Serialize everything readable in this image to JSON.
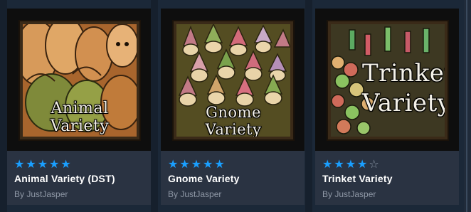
{
  "cards": [
    {
      "art_text": "Animal Variety",
      "rating": 5,
      "stars": [
        "★",
        "★",
        "★",
        "★",
        "★"
      ],
      "title": "Animal Variety (DST)",
      "author": "By JustJasper",
      "colors": {
        "bg": "#b9793a",
        "accent": "#6d7b2d"
      }
    },
    {
      "art_text": "Gnome Variety",
      "rating": 5,
      "stars": [
        "★",
        "★",
        "★",
        "★",
        "★"
      ],
      "title": "Gnome Variety",
      "author": "By JustJasper",
      "colors": {
        "bg": "#5a5224",
        "accent": "#c67e88"
      }
    },
    {
      "art_text_line1": "Trinket",
      "art_text_line2": "Variety",
      "rating": 4,
      "stars": [
        "★",
        "★",
        "★",
        "★",
        "☆"
      ],
      "title": "Trinket Variety",
      "author": "By JustJasper",
      "colors": {
        "bg": "#3f3a22",
        "accent": "#5eaa64"
      }
    }
  ]
}
